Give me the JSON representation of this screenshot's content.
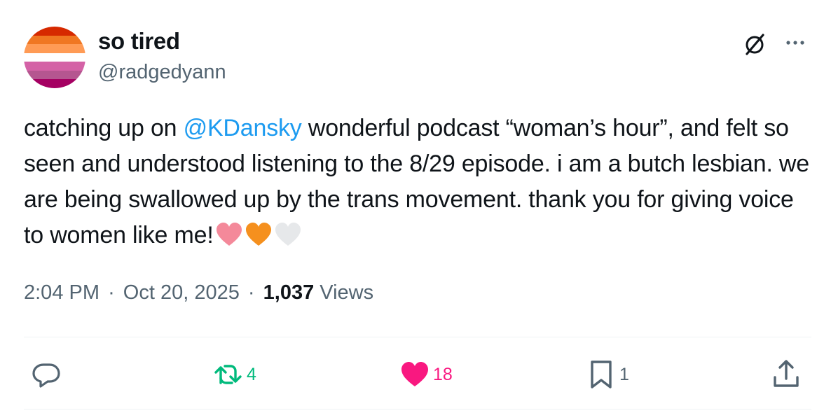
{
  "user": {
    "display_name": "so tired",
    "handle": "@radgedyann",
    "avatar_colors": [
      "#d62900",
      "#f07722",
      "#ff9b55",
      "#ffffff",
      "#d462a6",
      "#b55690",
      "#a50062"
    ]
  },
  "tweet": {
    "text_before": "catching up on ",
    "mention": "@KDansky",
    "text_after": " wonderful podcast “woman’s hour”, and felt so seen and understood listening to the 8/29 episode. i am a butch lesbian. we are being swallowed up by the trans movement. thank you for giving voice to women like me!",
    "emoji": [
      "pink-heart",
      "orange-heart",
      "white-heart"
    ]
  },
  "meta": {
    "time": "2:04 PM",
    "date": "Oct 20, 2025",
    "views_count": "1,037",
    "views_label": "Views",
    "separator": "·"
  },
  "actions": {
    "reply_count": "",
    "retweet_count": "4",
    "like_count": "18",
    "bookmark_count": "1"
  },
  "colors": {
    "accent": "#1d9bf0",
    "retweet": "#00ba7c",
    "like": "#f91880",
    "muted": "#536471"
  },
  "icons": {
    "grok": "grok-icon",
    "more": "more-icon",
    "reply": "reply-icon",
    "retweet": "retweet-icon",
    "like": "heart-icon",
    "bookmark": "bookmark-icon",
    "share": "share-icon"
  }
}
